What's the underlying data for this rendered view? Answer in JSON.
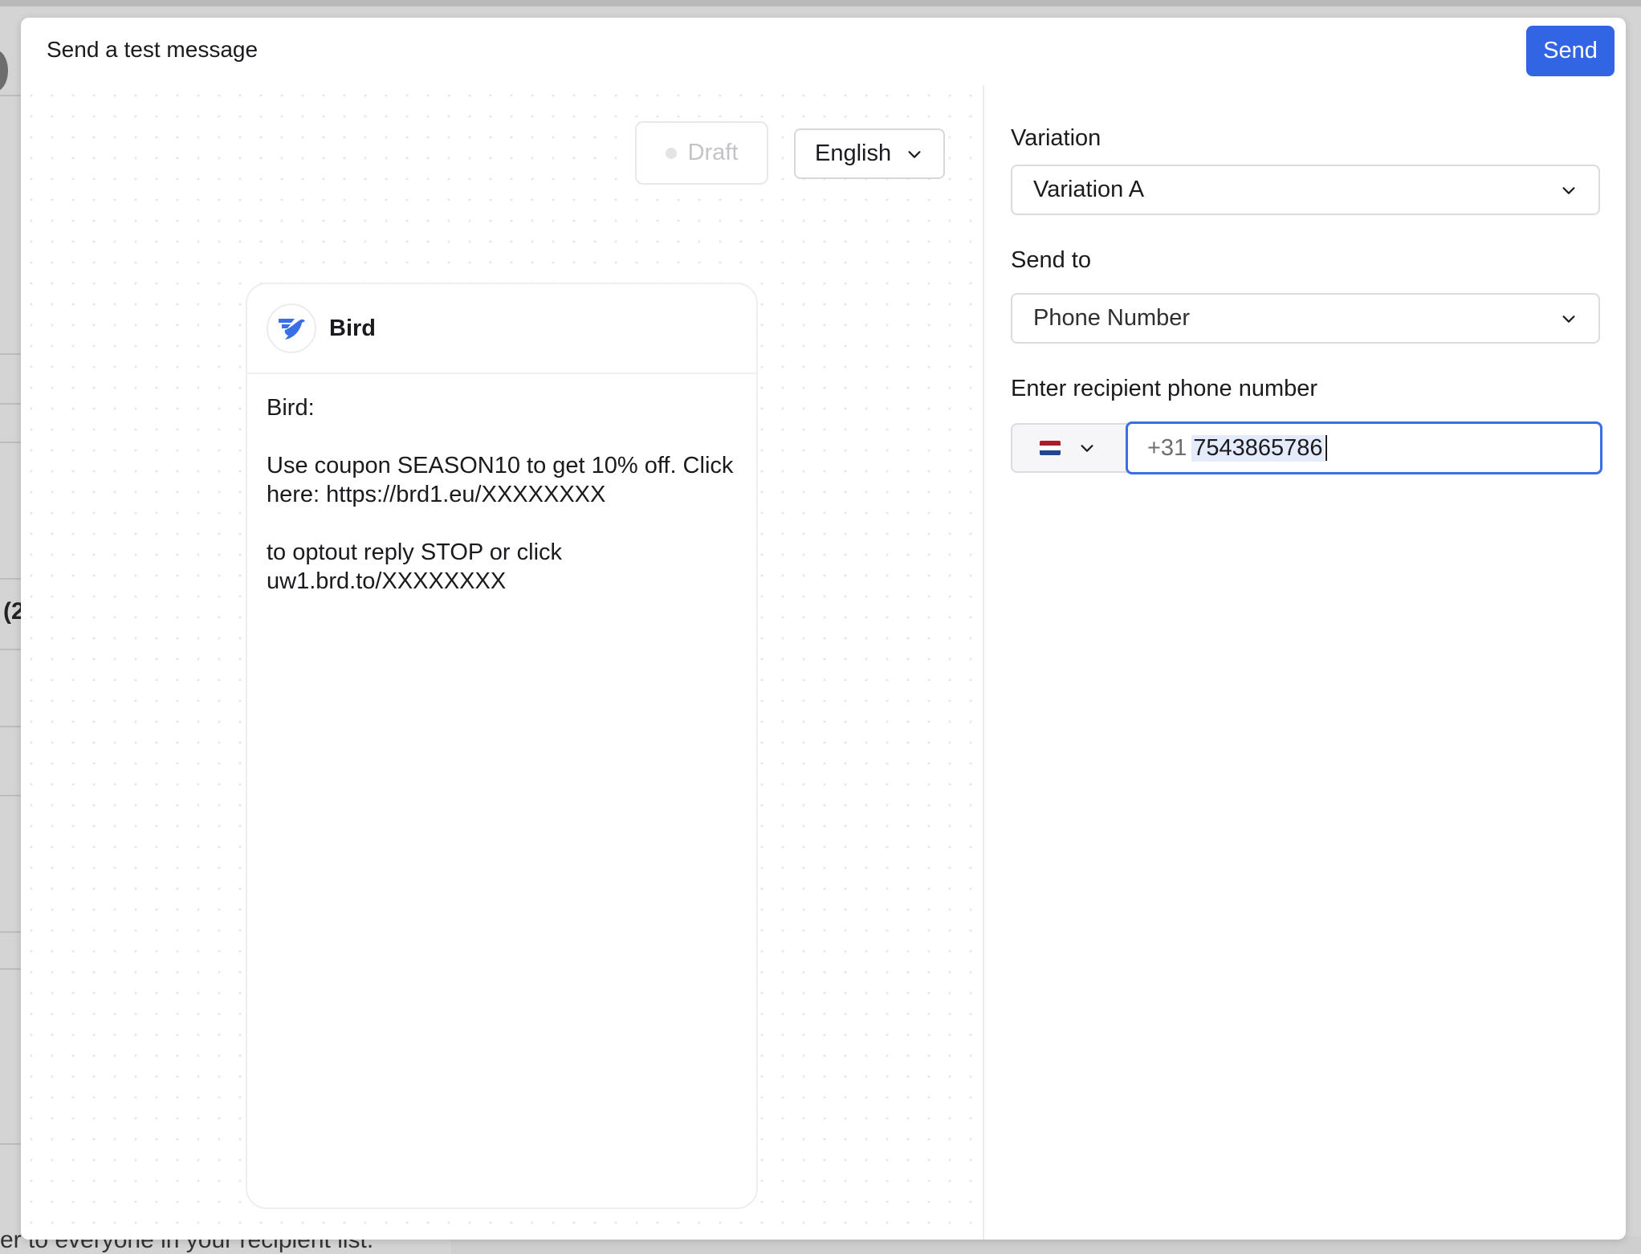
{
  "modal": {
    "title": "Send a test message",
    "send_label": "Send"
  },
  "preview": {
    "status_label": "Draft",
    "language_label": "English",
    "sender_name": "Bird",
    "message_body": "Bird:\n\nUse coupon SEASON10 to get 10% off. Click here: https://brd1.eu/XXXXXXXX\n\nto optout reply STOP or click uw1.brd.to/XXXXXXXX"
  },
  "settings": {
    "variation_label": "Variation",
    "variation_value": "Variation A",
    "send_to_label": "Send to",
    "send_to_value": "Phone Number",
    "recipient_label": "Enter recipient phone number",
    "country_flag": "netherlands-flag-icon",
    "dial_code": "+31",
    "phone_value": "7543865786"
  },
  "background": {
    "partial_label": "(2",
    "bottom_text": "er to everyone in your recipient list."
  },
  "colors": {
    "accent": "#3165e4",
    "focus_border": "#3a6ee6"
  }
}
